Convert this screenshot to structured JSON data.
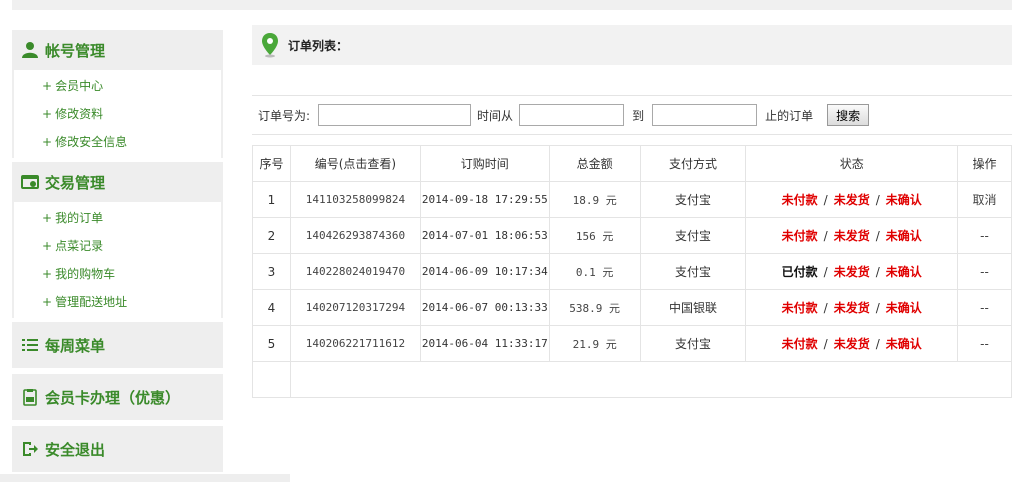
{
  "sidebar": {
    "account": {
      "title": "帐号管理",
      "items": [
        "会员中心",
        "修改资料",
        "修改安全信息"
      ]
    },
    "trade": {
      "title": "交易管理",
      "items": [
        "我的订单",
        "点菜记录",
        "我的购物车",
        "管理配送地址"
      ]
    },
    "weekly": {
      "title": "每周菜单"
    },
    "vip": {
      "title": "会员卡办理（优惠）"
    },
    "logout": {
      "title": "安全退出"
    },
    "plus": "+"
  },
  "main": {
    "title": "订单列表：",
    "filter": {
      "order_label": "订单号为:",
      "from_label": "时间从",
      "to_label": "到",
      "until_label": "止的订单",
      "search_button": "搜索",
      "order_value": "",
      "from_value": "",
      "to_value": ""
    },
    "table": {
      "headers": [
        "序号",
        "编号(点击查看)",
        "订购时间",
        "总金额",
        "支付方式",
        "状态",
        "操作"
      ],
      "status_sep": "/",
      "rows": [
        {
          "idx": "1",
          "num": "141103258099824",
          "time": "2014-09-18 17:29:55",
          "amount": "18.9 元",
          "pay": "支付宝",
          "s1": "未付款",
          "s2": "未发货",
          "s3": "未确认",
          "op": "取消"
        },
        {
          "idx": "2",
          "num": "140426293874360",
          "time": "2014-07-01 18:06:53",
          "amount": "156 元",
          "pay": "支付宝",
          "s1": "未付款",
          "s2": "未发货",
          "s3": "未确认",
          "op": "--"
        },
        {
          "idx": "3",
          "num": "140228024019470",
          "time": "2014-06-09 10:17:34",
          "amount": "0.1 元",
          "pay": "支付宝",
          "s1": "已付款",
          "s2": "未发货",
          "s3": "未确认",
          "op": "--"
        },
        {
          "idx": "4",
          "num": "140207120317294",
          "time": "2014-06-07 00:13:33",
          "amount": "538.9 元",
          "pay": "中国银联",
          "s1": "未付款",
          "s2": "未发货",
          "s3": "未确认",
          "op": "--"
        },
        {
          "idx": "5",
          "num": "140206221711612",
          "time": "2014-06-04 11:33:17",
          "amount": "21.9 元",
          "pay": "支付宝",
          "s1": "未付款",
          "s2": "未发货",
          "s3": "未确认",
          "op": "--"
        }
      ]
    }
  },
  "colors": {
    "green": "#3a8a2a",
    "red": "#e00000"
  }
}
